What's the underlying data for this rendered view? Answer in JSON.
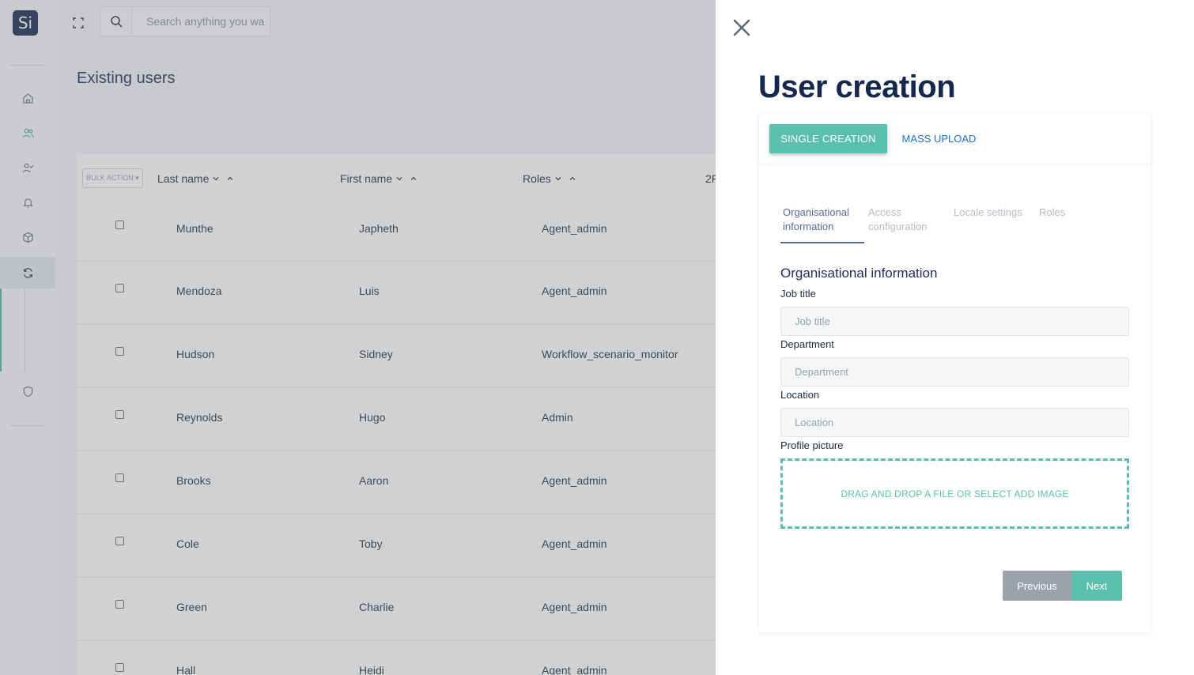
{
  "sidebar": {
    "logo_text": "Si",
    "icons": [
      "home-icon",
      "users-icon",
      "user-check-icon",
      "bell-icon",
      "box-icon",
      "refresh-icon",
      "shield-icon"
    ]
  },
  "search": {
    "placeholder": "Search anything you wa"
  },
  "page": {
    "title": "Existing users"
  },
  "table": {
    "bulk_action": "BULK ACTION ▾",
    "headers": {
      "last_name": "Last name",
      "first_name": "First name",
      "roles": "Roles",
      "twofa": "2F"
    },
    "rows": [
      {
        "last": "Munthe",
        "first": "Japheth",
        "role": "Agent_admin"
      },
      {
        "last": "Mendoza",
        "first": "Luis",
        "role": "Agent_admin"
      },
      {
        "last": "Hudson",
        "first": "Sidney",
        "role": "Workflow_scenario_monitor"
      },
      {
        "last": "Reynolds",
        "first": "Hugo",
        "role": "Admin"
      },
      {
        "last": "Brooks",
        "first": "Aaron",
        "role": "Agent_admin"
      },
      {
        "last": "Cole",
        "first": "Toby",
        "role": "Agent_admin"
      },
      {
        "last": "Green",
        "first": "Charlie",
        "role": "Agent_admin"
      },
      {
        "last": "Hall",
        "first": "Heidi",
        "role": "Agent_admin"
      }
    ]
  },
  "panel": {
    "title": "User creation",
    "tab_single": "SINGLE CREATION",
    "tab_mass": "MASS UPLOAD",
    "steps": {
      "org_line1": "Organisational",
      "org_line2": "information",
      "access_line1": "Access",
      "access_line2": "configuration",
      "locale": "Locale settings",
      "roles": "Roles"
    },
    "section_title": "Organisational information",
    "fields": {
      "job_title_label": "Job title",
      "job_title_placeholder": "Job title",
      "department_label": "Department",
      "department_placeholder": "Department",
      "location_label": "Location",
      "location_placeholder": "Location",
      "picture_label": "Profile picture"
    },
    "dropzone_text": "DRAG AND DROP A FILE OR SELECT ADD IMAGE",
    "previous": "Previous",
    "next": "Next"
  },
  "colors": {
    "accent": "#5bbfae",
    "navy": "#14274e",
    "link": "#1a6fd6"
  }
}
